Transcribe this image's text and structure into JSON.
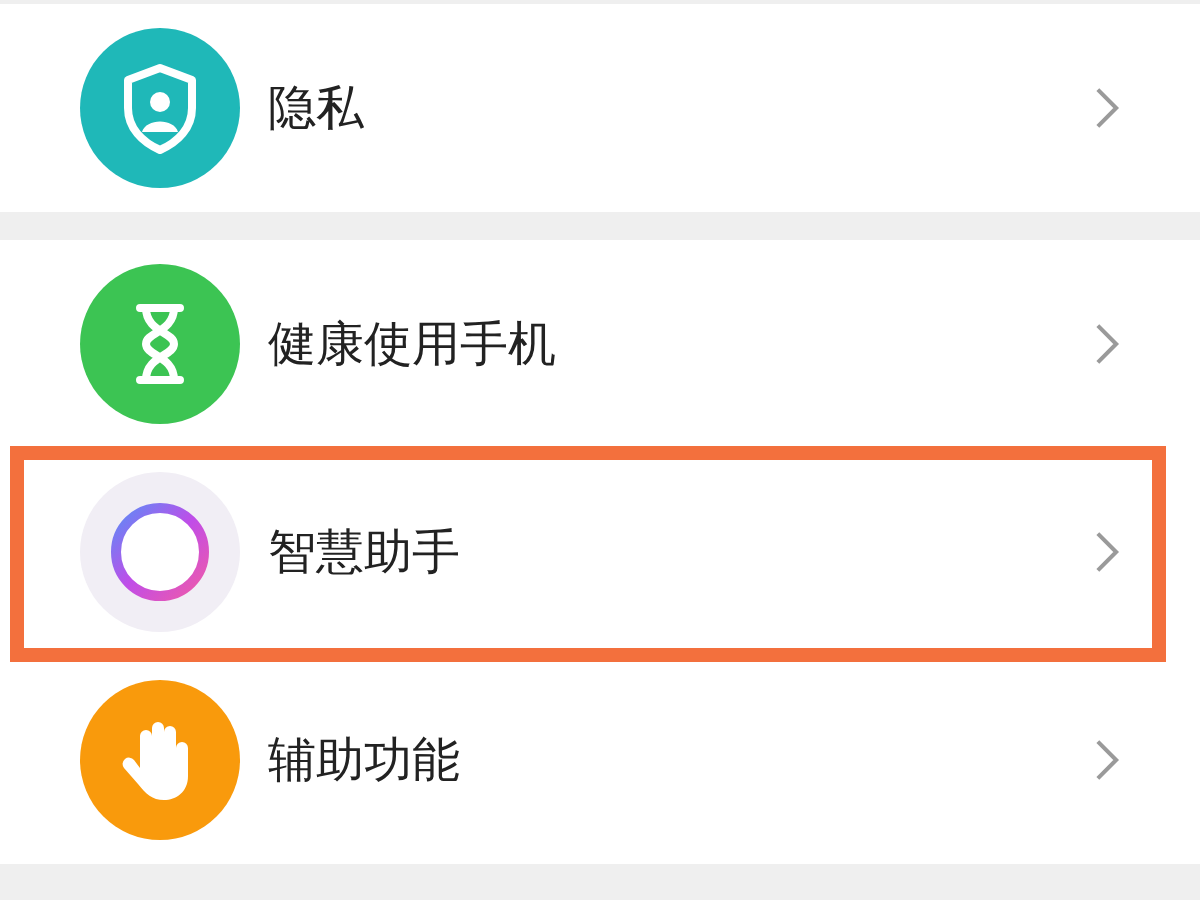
{
  "groups": [
    {
      "items": [
        {
          "label": "隐私",
          "kind": "shield",
          "color": "#1fb8b8",
          "highlighted": false
        }
      ]
    },
    {
      "items": [
        {
          "label": "健康使用手机",
          "kind": "hourglass",
          "color": "#3cc453",
          "highlighted": false
        },
        {
          "label": "智慧助手",
          "kind": "ring",
          "color": "#f1eef5",
          "highlighted": true
        },
        {
          "label": "辅助功能",
          "kind": "hand",
          "color": "#f99a0c",
          "highlighted": false
        }
      ]
    }
  ]
}
